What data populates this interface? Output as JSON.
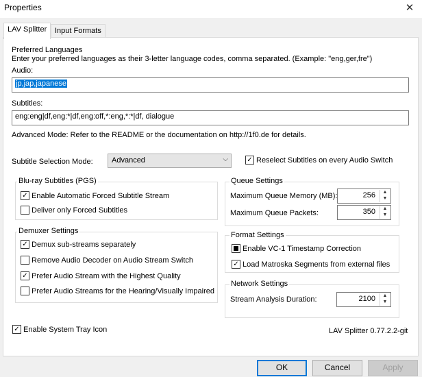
{
  "window": {
    "title": "Properties",
    "close_glyph": "✕"
  },
  "tabs": [
    {
      "label": "LAV Splitter",
      "active": true
    },
    {
      "label": "Input Formats",
      "active": false
    }
  ],
  "preferred_languages": {
    "heading": "Preferred Languages",
    "description": "Enter your preferred languages as their 3-letter language codes, comma separated. (Example: \"eng,ger,fre\")",
    "audio_label": "Audio:",
    "audio_value": "jp,jap,japanese",
    "subtitles_label": "Subtitles:",
    "subtitles_value": "eng:eng|df,eng:*|df,eng:off,*:eng,*:*|df, dialogue",
    "advanced_note": "Advanced Mode: Refer to the README or the documentation on http://1f0.de for details."
  },
  "subtitle_mode": {
    "label": "Subtitle Selection Mode:",
    "value": "Advanced",
    "reselect_label": "Reselect Subtitles on every Audio Switch",
    "reselect_checked": true
  },
  "bluray": {
    "title": "Blu-ray Subtitles (PGS)",
    "options": [
      {
        "label": "Enable Automatic Forced Subtitle Stream",
        "checked": true
      },
      {
        "label": "Deliver only Forced Subtitles",
        "checked": false
      }
    ]
  },
  "demuxer": {
    "title": "Demuxer Settings",
    "options": [
      {
        "label": "Demux sub-streams separately",
        "checked": true
      },
      {
        "label": "Remove Audio Decoder on Audio Stream Switch",
        "checked": false
      },
      {
        "label": "Prefer Audio Stream with the Highest Quality",
        "checked": true
      },
      {
        "label": "Prefer Audio Streams for the Hearing/Visually Impaired",
        "checked": false
      }
    ]
  },
  "queue": {
    "title": "Queue Settings",
    "memory_label": "Maximum Queue Memory (MB):",
    "memory_value": "256",
    "packets_label": "Maximum Queue Packets:",
    "packets_value": "350"
  },
  "format": {
    "title": "Format Settings",
    "vc1_label": "Enable VC-1 Timestamp Correction",
    "vc1_state": "indeterminate",
    "matroska_label": "Load Matroska Segments from external files",
    "matroska_checked": true
  },
  "network": {
    "title": "Network Settings",
    "duration_label": "Stream Analysis Duration:",
    "duration_value": "2100"
  },
  "tray": {
    "label": "Enable System Tray Icon",
    "checked": true
  },
  "version": "LAV Splitter 0.77.2.2-git",
  "buttons": {
    "ok": "OK",
    "cancel": "Cancel",
    "apply": "Apply"
  },
  "icons": {
    "check": "✓",
    "up": "▲",
    "down": "▼",
    "dropdown": "⌵"
  },
  "colors": {
    "accent": "#0078d7",
    "selection_bg": "#0078d7"
  }
}
